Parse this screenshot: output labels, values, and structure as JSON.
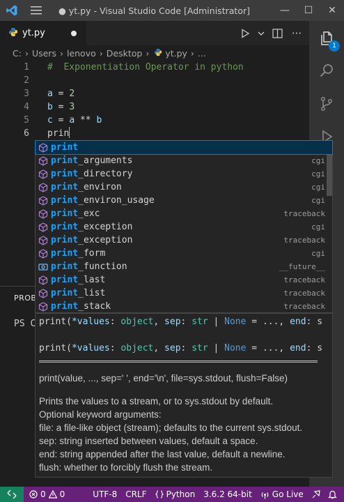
{
  "window": {
    "title": "● yt.py - Visual Studio Code [Administrator]",
    "controls": {
      "minimize": "—",
      "maximize": "☐",
      "close": "✕"
    }
  },
  "tab": {
    "label": "yt.py"
  },
  "breadcrumb": [
    "C:",
    "Users",
    "lenovo",
    "Desktop",
    "yt.py",
    "..."
  ],
  "editor": {
    "lines": [
      {
        "num": "1",
        "tokens": [
          {
            "t": "#  Exponentiation Operator in python",
            "c": "comment"
          }
        ]
      },
      {
        "num": "2",
        "tokens": []
      },
      {
        "num": "3",
        "tokens": [
          {
            "t": "a",
            "c": "var"
          },
          {
            "t": " = ",
            "c": "op"
          },
          {
            "t": "2",
            "c": "num"
          }
        ]
      },
      {
        "num": "4",
        "tokens": [
          {
            "t": "b",
            "c": "var"
          },
          {
            "t": " = ",
            "c": "op"
          },
          {
            "t": "3",
            "c": "num"
          }
        ]
      },
      {
        "num": "5",
        "tokens": [
          {
            "t": "c",
            "c": "var"
          },
          {
            "t": " = ",
            "c": "op"
          },
          {
            "t": "a",
            "c": "var"
          },
          {
            "t": " ** ",
            "c": "op"
          },
          {
            "t": "b",
            "c": "var"
          }
        ]
      },
      {
        "num": "6",
        "tokens": [
          {
            "t": "prin",
            "c": "op"
          }
        ],
        "cursor": true
      }
    ]
  },
  "panel": {
    "tab_label": "PROBL",
    "terminal_text": "PS C"
  },
  "suggest": {
    "query": "print",
    "items": [
      {
        "prefix": "print",
        "rest": "",
        "detail": "",
        "kind": "cube"
      },
      {
        "prefix": "print",
        "rest": "_arguments",
        "detail": "cgi",
        "kind": "cube"
      },
      {
        "prefix": "print",
        "rest": "_directory",
        "detail": "cgi",
        "kind": "cube"
      },
      {
        "prefix": "print",
        "rest": "_environ",
        "detail": "cgi",
        "kind": "cube"
      },
      {
        "prefix": "print",
        "rest": "_environ_usage",
        "detail": "cgi",
        "kind": "cube"
      },
      {
        "prefix": "print",
        "rest": "_exc",
        "detail": "traceback",
        "kind": "cube"
      },
      {
        "prefix": "print",
        "rest": "_exception",
        "detail": "cgi",
        "kind": "cube"
      },
      {
        "prefix": "print",
        "rest": "_exception",
        "detail": "traceback",
        "kind": "cube"
      },
      {
        "prefix": "print",
        "rest": "_form",
        "detail": "cgi",
        "kind": "cube"
      },
      {
        "prefix": "print",
        "rest": "_function",
        "detail": "__future__",
        "kind": "field"
      },
      {
        "prefix": "print",
        "rest": "_last",
        "detail": "traceback",
        "kind": "cube"
      },
      {
        "prefix": "print",
        "rest": "_list",
        "detail": "traceback",
        "kind": "cube"
      },
      {
        "prefix": "print",
        "rest": "_stack",
        "detail": "traceback",
        "kind": "cube"
      }
    ]
  },
  "hint": {
    "signature": [
      {
        "t": "print(",
        "c": ""
      },
      {
        "t": "*values",
        "c": "p"
      },
      {
        "t": ": ",
        "c": ""
      },
      {
        "t": "object",
        "c": "t"
      },
      {
        "t": ", ",
        "c": ""
      },
      {
        "t": "sep",
        "c": "p"
      },
      {
        "t": ": ",
        "c": ""
      },
      {
        "t": "str",
        "c": "t"
      },
      {
        "t": " | ",
        "c": ""
      },
      {
        "t": "None",
        "c": "k"
      },
      {
        "t": " = ..., ",
        "c": ""
      },
      {
        "t": "end",
        "c": "p"
      },
      {
        "t": ": s",
        "c": ""
      }
    ],
    "doc_signature": "print(value, ..., sep=' ', end='\\n', file=sys.stdout, flush=False)",
    "doc_lines": [
      "Prints the values to a stream, or to sys.stdout by default.",
      "Optional keyword arguments:",
      "file: a file-like object (stream); defaults to the current sys.stdout.",
      "sep: string inserted between values, default a space.",
      "end: string appended after the last value, default a newline.",
      "flush: whether to forcibly flush the stream."
    ]
  },
  "activity": {
    "explorer_badge": "1"
  },
  "status": {
    "errors": "0",
    "warnings": "0",
    "encoding": "UTF-8",
    "eol": "CRLF",
    "language": "Python",
    "interpreter": "3.6.2 64-bit",
    "golive": "Go Live"
  },
  "colors": {
    "statusbar": "#68217a",
    "remote": "#16825d",
    "accent": "#007acc",
    "match_highlight": "#18a3ff"
  }
}
